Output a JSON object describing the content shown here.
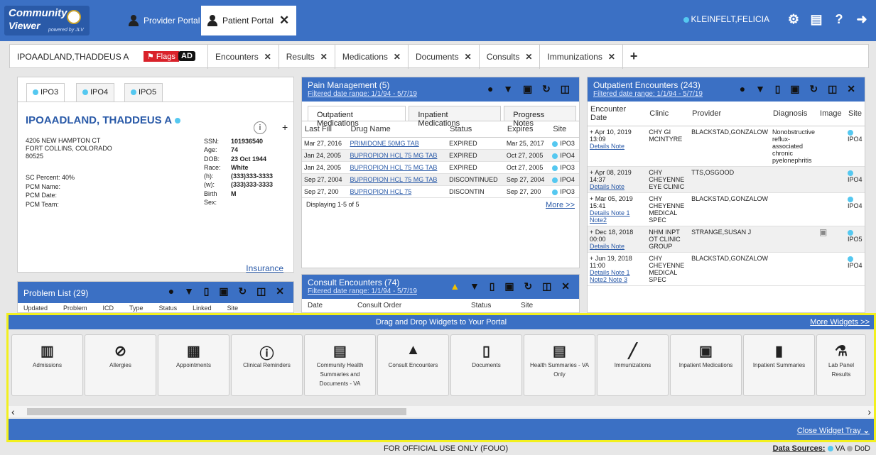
{
  "app": {
    "logo_line1": "Community",
    "logo_line2": "Viewer",
    "logo_powered": "powered by JLV"
  },
  "tabs": {
    "provider": "Provider Portal",
    "patient": "Patient Portal"
  },
  "user": {
    "name": "KLEINFELT,FELICIA"
  },
  "patient_bar": {
    "name": "IPOAADLAND,THADDEUS A",
    "flags": "Flags",
    "ad": "AD",
    "tabs": [
      "Encounters",
      "Results",
      "Medications",
      "Documents",
      "Consults",
      "Immunizations"
    ]
  },
  "demographics": {
    "sites": [
      "IPO3",
      "IPO4",
      "IPO5"
    ],
    "name": "IPOAADLAND, THADDEUS A",
    "address": [
      "4206 NEW HAMPTON CT",
      "FORT COLLINS, COLORADO",
      "80525"
    ],
    "sc_lines": [
      "SC Percent:  40%",
      "PCM Name:",
      "PCM Date:",
      "PCM Team:"
    ],
    "fields": [
      {
        "k": "SSN:",
        "v": "101936540"
      },
      {
        "k": "Age:",
        "v": "74"
      },
      {
        "k": "DOB:",
        "v": "23 Oct 1944"
      },
      {
        "k": "Race:",
        "v": "White"
      },
      {
        "k": "(h):",
        "v": "(333)333-3333"
      },
      {
        "k": "(w):",
        "v": "(333)333-3333"
      },
      {
        "k": "Birth Sex:",
        "v": "M"
      }
    ],
    "insurance": "Insurance"
  },
  "problem_list": {
    "title": "Problem List (29)",
    "cols": [
      "Updated",
      "Problem",
      "ICD",
      "Type",
      "Status",
      "Linked",
      "Site"
    ]
  },
  "pain": {
    "title": "Pain Management (5)",
    "filter": "Filtered date range: 1/1/94 - 5/7/19",
    "subtabs": [
      "Outpatient Medications",
      "Inpatient Medications",
      "Progress Notes"
    ],
    "cols": [
      "Last Fill",
      "Drug Name",
      "Status",
      "Expires",
      "Site"
    ],
    "rows": [
      [
        "Mar 27, 2016",
        "PRIMIDONE 50MG TAB",
        "EXPIRED",
        "Mar 25, 2017",
        "IPO3"
      ],
      [
        "Jan 24, 2005",
        "BUPROPION HCL 75 MG TAB",
        "EXPIRED",
        "Oct 27, 2005",
        "IPO4"
      ],
      [
        "Jan 24, 2005",
        "BUPROPION HCL 75 MG TAB",
        "EXPIRED",
        "Oct 27, 2005",
        "IPO3"
      ],
      [
        "Sep 27, 2004",
        "BUPROPION HCL 75 MG TAB",
        "DISCONTINUED",
        "Sep 27, 2004",
        "IPO4"
      ],
      [
        "Sep 27, 200",
        "BUPROPION HCL 75",
        "DISCONTIN",
        "Sep 27, 200",
        "IPO3"
      ]
    ],
    "displaying": "Displaying 1-5 of 5",
    "more": "More >>"
  },
  "consult": {
    "title": "Consult Encounters (74)",
    "filter": "Filtered date range: 1/1/94 - 5/7/19",
    "cols": [
      "Date",
      "Consult Order",
      "Status",
      "Site"
    ]
  },
  "outpatient": {
    "title": "Outpatient Encounters (243)",
    "filter": "Filtered date range: 1/1/94 - 5/7/19",
    "cols": [
      "Encounter Date",
      "Clinic",
      "Provider",
      "Diagnosis",
      "Image",
      "Site"
    ],
    "rows": [
      {
        "date": "Apr 10, 2019 13:09",
        "links": "Details Note",
        "clinic": "CHY GI MCINTYRE",
        "provider": "BLACKSTAD,GONZALOW",
        "diag": "Nonobstructive reflux-associated chronic pyelonephritis",
        "site": "IPO4"
      },
      {
        "date": "Apr 08, 2019 14:37",
        "links": "Details Note",
        "clinic": "CHY CHEYENNE EYE CLINIC",
        "provider": "TTS,OSGOOD",
        "diag": "",
        "site": "IPO4"
      },
      {
        "date": "Mar 05, 2019 15:41",
        "links": "Details Note 1 Note2",
        "clinic": "CHY CHEYENNE MEDICAL SPEC",
        "provider": "BLACKSTAD,GONZALOW",
        "diag": "",
        "site": "IPO4"
      },
      {
        "date": "Dec 18, 2018 00:00",
        "links": "Details Note",
        "clinic": "NHM INPT OT CLINIC GROUP",
        "provider": "STRANGE,SUSAN J",
        "diag": "",
        "site": "IPO5"
      },
      {
        "date": "Jun 19, 2018 11:00",
        "links": "Details Note 1 Note2 Note 3",
        "clinic": "CHY CHEYENNE MEDICAL SPEC",
        "provider": "BLACKSTAD,GONZALOW",
        "diag": "",
        "site": "IPO4"
      }
    ]
  },
  "tray": {
    "title": "Drag and Drop Widgets to Your Portal",
    "more": "More Widgets >>",
    "close": "Close Widget Tray",
    "widgets": [
      "Admissions",
      "Allergies",
      "Appointments",
      "Clinical Reminders",
      "Community Health Summaries and Documents - VA",
      "Consult Encounters",
      "Documents",
      "Health Summaries - VA Only",
      "Immunizations",
      "Inpatient Medications",
      "Inpatient Summaries",
      "Lab Panel Results"
    ]
  },
  "status": {
    "center": "FOR OFFICIAL USE ONLY (FOUO)",
    "sources_label": "Data Sources:",
    "va": "VA",
    "dod": "DoD"
  }
}
